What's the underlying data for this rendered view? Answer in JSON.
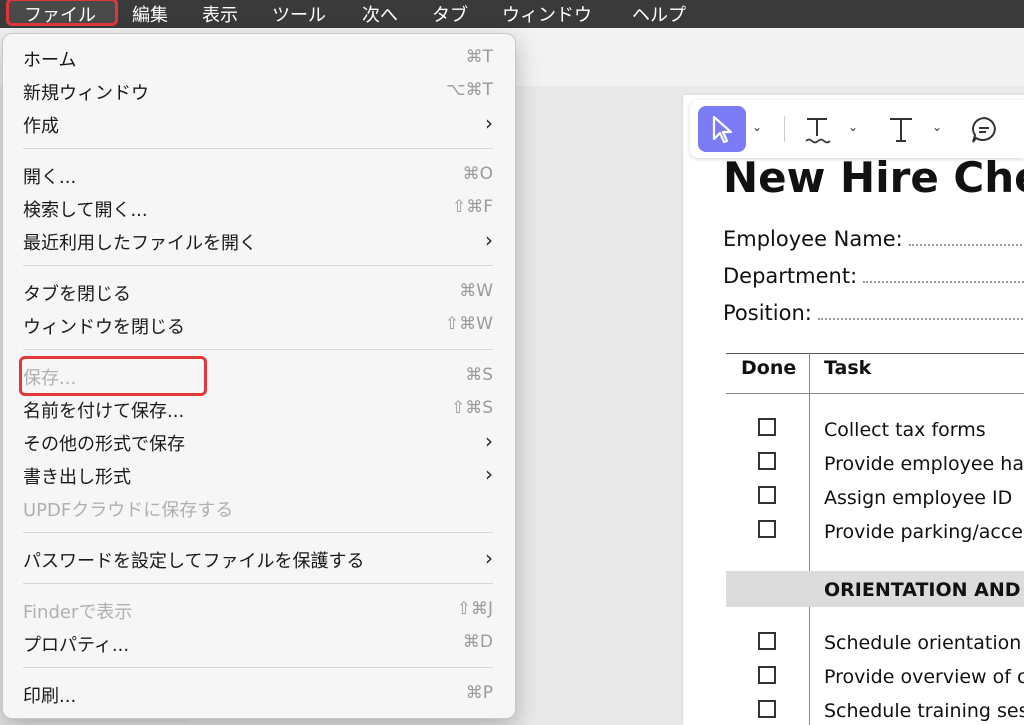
{
  "menubar": {
    "file": "ファイル",
    "edit": "編集",
    "view": "表示",
    "tools": "ツール",
    "go": "次へ",
    "tab": "タブ",
    "window": "ウィンドウ",
    "help": "ヘルプ"
  },
  "menu": {
    "home": {
      "label": "ホーム",
      "shortcut": "⌘T"
    },
    "new_window": {
      "label": "新規ウィンドウ",
      "shortcut": "⌥⌘T"
    },
    "create": {
      "label": "作成"
    },
    "open": {
      "label": "開く...",
      "shortcut": "⌘O"
    },
    "search_open": {
      "label": "検索して開く...",
      "shortcut": "⇧⌘F"
    },
    "recent": {
      "label": "最近利用したファイルを開く"
    },
    "close_tab": {
      "label": "タブを閉じる",
      "shortcut": "⌘W"
    },
    "close_window": {
      "label": "ウィンドウを閉じる",
      "shortcut": "⇧⌘W"
    },
    "save": {
      "label": "保存...",
      "shortcut": "⌘S"
    },
    "save_as": {
      "label": "名前を付けて保存...",
      "shortcut": "⇧⌘S"
    },
    "save_other": {
      "label": "その他の形式で保存"
    },
    "export": {
      "label": "書き出し形式"
    },
    "cloud": {
      "label": "UPDFクラウドに保存する"
    },
    "password": {
      "label": "パスワードを設定してファイルを保護する"
    },
    "finder": {
      "label": "Finderで表示",
      "shortcut": "⇧⌘J"
    },
    "properties": {
      "label": "プロパティ...",
      "shortcut": "⌘D"
    },
    "print": {
      "label": "印刷...",
      "shortcut": "⌘P"
    }
  },
  "document": {
    "title": "New Hire Che",
    "employee_name": "Employee Name:",
    "department": "Department:",
    "position": "Position:",
    "col_done": "Done",
    "col_task": "Task",
    "tasks_a": [
      "Collect tax forms",
      "Provide employee ha",
      "Assign employee ID",
      "Provide parking/acce"
    ],
    "section": "ORIENTATION AND",
    "tasks_b": [
      "Schedule orientation",
      "Provide overview of c",
      "Schedule training ses"
    ]
  },
  "colors": {
    "accent": "#7b7bf5",
    "highlight": "#e0373b",
    "menubar": "#3a3a3a"
  }
}
